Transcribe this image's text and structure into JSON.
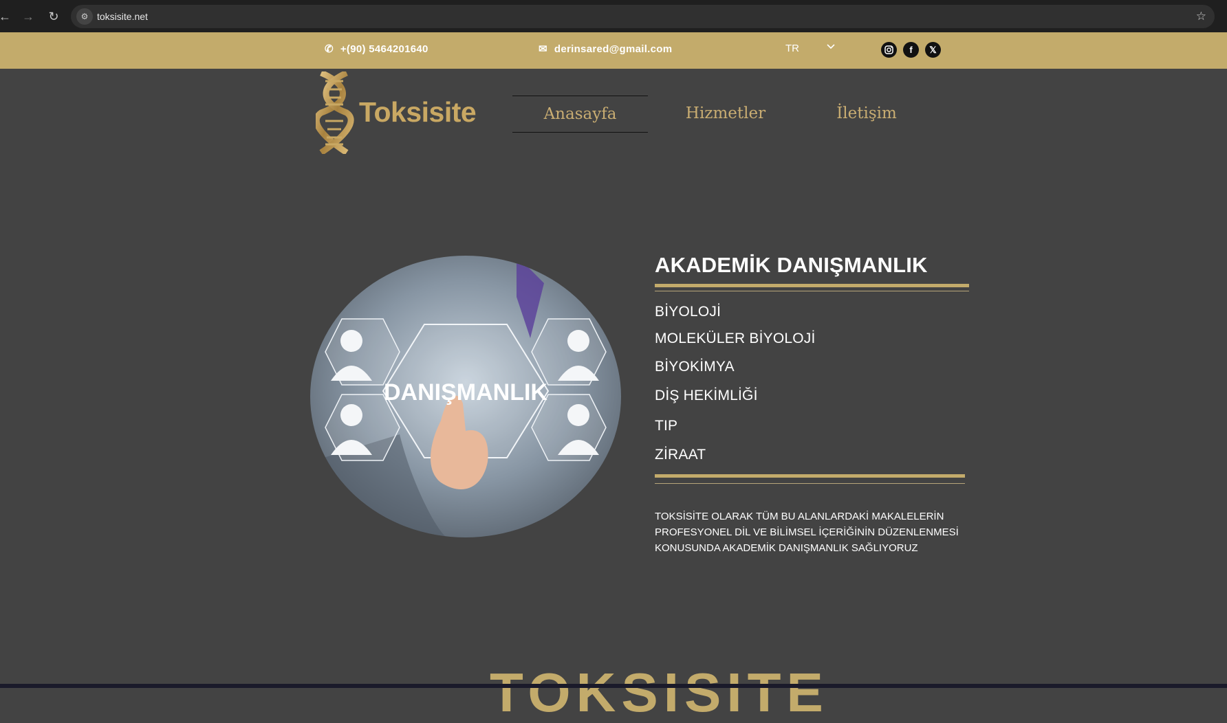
{
  "browser": {
    "url": "toksisite.net"
  },
  "topbar": {
    "phone": "+(90) 5464201640",
    "email": "derinsared@gmail.com",
    "language": "TR",
    "social": [
      "instagram",
      "facebook",
      "x"
    ]
  },
  "header": {
    "logo_text": "Toksisite",
    "nav": [
      {
        "label": "Anasayfa",
        "active": true
      },
      {
        "label": "Hizmetler",
        "active": false
      },
      {
        "label": "İletişim",
        "active": false
      }
    ]
  },
  "hero": {
    "image_text": "DANIŞMANLIK",
    "title": "AKADEMİK DANIŞMANLIK",
    "fields": [
      "BİYOLOJİ",
      "MOLEKÜLER BİYOLOJİ",
      "BİYOKİMYA",
      "DİŞ HEKİMLİĞİ",
      "TIP",
      "ZİRAAT"
    ],
    "description": "TOKSİSİTE OLARAK TÜM BU ALANLARDAKİ MAKALELERİN PROFESYONEL DİL VE BİLİMSEL İÇERİĞİNİN DÜZENLENMESİ KONUSUNDA AKADEMİK DANIŞMANLIK SAĞLIYORUZ"
  },
  "footer_brand": "TOKSISITE",
  "colors": {
    "gold": "#c3ab6b",
    "background": "#434343"
  }
}
